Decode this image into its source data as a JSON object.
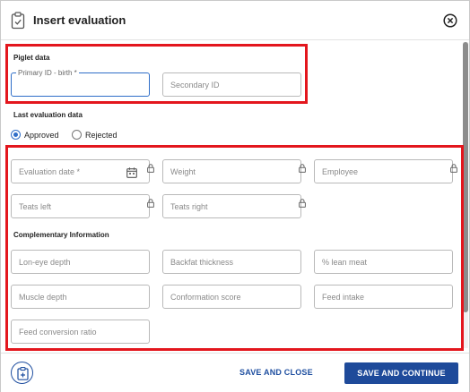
{
  "header": {
    "title": "Insert evaluation",
    "icon": "clipboard-check-icon",
    "close_icon": "close-circle-icon"
  },
  "piglet_section": {
    "label": "Piglet data",
    "primary_id": {
      "label": "Primary ID - birth *",
      "value": ""
    },
    "secondary_id": {
      "placeholder": "Secondary ID",
      "value": ""
    }
  },
  "last_evaluation": {
    "label": "Last evaluation data",
    "options": [
      {
        "label": "Approved",
        "selected": true
      },
      {
        "label": "Rejected",
        "selected": false
      }
    ]
  },
  "evaluation_fields": {
    "evaluation_date": "Evaluation date *",
    "weight": "Weight",
    "employee": "Employee",
    "teats_left": "Teats left",
    "teats_right": "Teats right"
  },
  "complementary": {
    "label": "Complementary Information",
    "fields": {
      "lon_eye_depth": "Lon-eye depth",
      "backfat_thickness": "Backfat thickness",
      "lean_meat": "% lean meat",
      "muscle_depth": "Muscle depth",
      "conformation_score": "Conformation score",
      "feed_intake": "Feed intake",
      "feed_conversion_ratio": "Feed conversion ratio"
    }
  },
  "footer": {
    "save_and_close": "SAVE AND CLOSE",
    "save_and_continue": "SAVE AND CONTINUE"
  },
  "colors": {
    "primary": "#1e4a9a",
    "focus": "#2f6ec8",
    "highlight": "#e3161d"
  }
}
